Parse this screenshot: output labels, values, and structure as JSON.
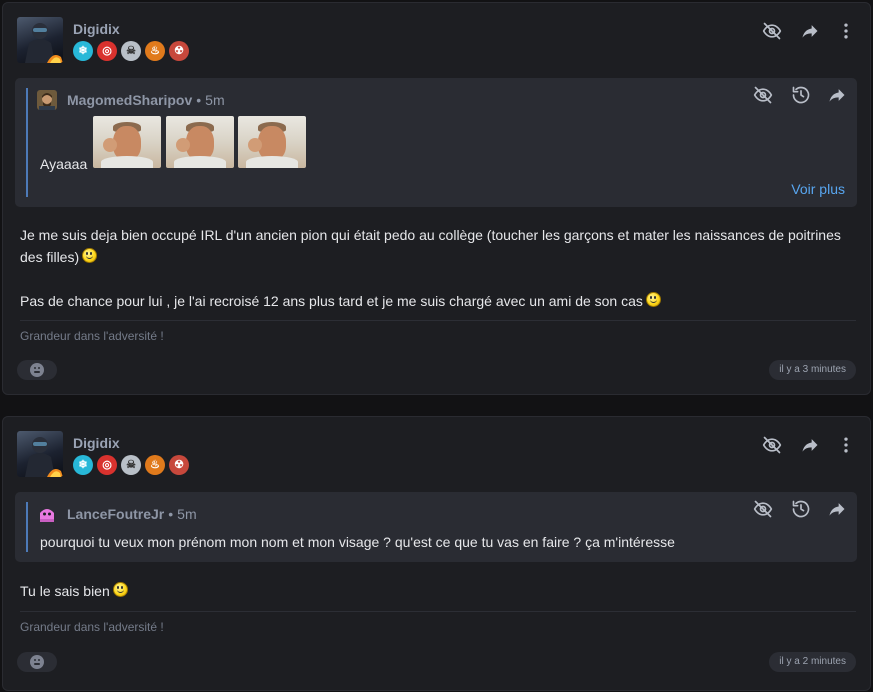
{
  "posts": [
    {
      "author": "Digidix",
      "badges": [
        "ice-badge",
        "target-badge",
        "skull-badge",
        "fire-badge",
        "demon-badge"
      ],
      "quote": {
        "author": "MagomedSharipov",
        "sep": "•",
        "time": "5m",
        "text": "Ayaaaa",
        "images": [
          "crying-man-meme",
          "crying-man-meme",
          "crying-man-meme"
        ],
        "more_label": "Voir plus"
      },
      "paragraphs": [
        "Je me suis deja bien occupé IRL d'un ancien pion qui était pedo au collège (toucher les garçons et mater les naissances de poitrines des filles)",
        "Pas de chance pour lui , je l'ai recroisé 12 ans plus tard et je me suis chargé avec un ami de son cas"
      ],
      "signature": "Grandeur dans l'adversité !",
      "timestamp": "il y a 3 minutes"
    },
    {
      "author": "Digidix",
      "badges": [
        "ice-badge",
        "target-badge",
        "skull-badge",
        "fire-badge",
        "demon-badge"
      ],
      "quote": {
        "author": "LanceFoutreJr",
        "sep": "•",
        "time": "5m",
        "text": "pourquoi tu veux mon prénom mon nom et mon visage ? qu'est ce que tu vas en faire ? ça m'intéresse"
      },
      "paragraphs": [
        "Tu le sais bien"
      ],
      "signature": "Grandeur dans l'adversité !",
      "timestamp": "il y a 2 minutes"
    }
  ],
  "icons": {
    "hide": "eye-off-icon",
    "share": "share-icon",
    "more": "more-vertical-icon",
    "history": "history-icon",
    "reaction": "reaction-icon"
  }
}
